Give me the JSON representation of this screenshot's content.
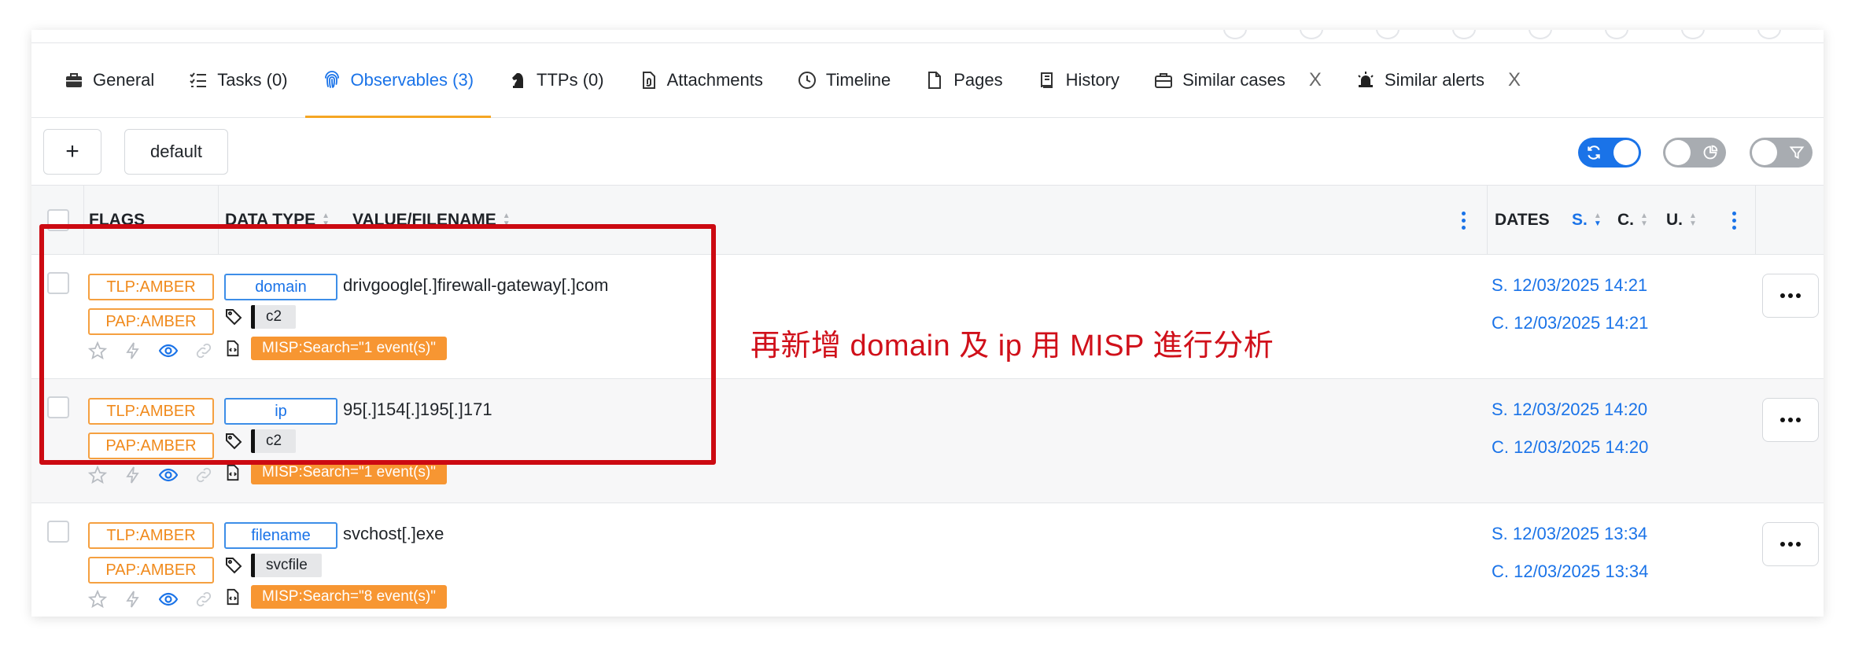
{
  "tabs": [
    {
      "label": "General",
      "icon": "briefcase-icon"
    },
    {
      "label": "Tasks (0)",
      "icon": "checklist-icon"
    },
    {
      "label": "Observables (3)",
      "icon": "fingerprint-icon",
      "active": true
    },
    {
      "label": "TTPs (0)",
      "icon": "chess-knight-icon"
    },
    {
      "label": "Attachments",
      "icon": "file-attachment-icon"
    },
    {
      "label": "Timeline",
      "icon": "clock-icon"
    },
    {
      "label": "Pages",
      "icon": "page-icon"
    },
    {
      "label": "History",
      "icon": "book-icon"
    },
    {
      "label": "Similar cases",
      "icon": "briefcase-icon",
      "closable": true
    },
    {
      "label": "Similar alerts",
      "icon": "siren-icon",
      "closable": true
    }
  ],
  "tab_close_symbol": "X",
  "toolbar": {
    "add_label": "+",
    "preset_label": "default",
    "toggles": [
      {
        "name": "auto-refresh",
        "state": "on",
        "icon": "refresh-icon"
      },
      {
        "name": "stats",
        "state": "off",
        "icon": "pie-chart-icon"
      },
      {
        "name": "filters",
        "state": "off",
        "icon": "filter-icon"
      }
    ]
  },
  "table": {
    "headers": {
      "flags": "FLAGS",
      "data_type": "DATA TYPE",
      "value": "VALUE/FILENAME",
      "dates": "DATES",
      "date_s": "S.",
      "date_c": "C.",
      "date_u": "U."
    },
    "rows": [
      {
        "tlp": "TLP:AMBER",
        "pap": "PAP:AMBER",
        "data_type": "domain",
        "value": "drivgoogle[.]firewall-gateway[.]com",
        "tag": "c2",
        "analyzer": "MISP:Search=\"1 event(s)\"",
        "start_date": "S. 12/03/2025 14:21",
        "created_date": "C. 12/03/2025 14:21"
      },
      {
        "tlp": "TLP:AMBER",
        "pap": "PAP:AMBER",
        "data_type": "ip",
        "value": "95[.]154[.]195[.]171",
        "tag": "c2",
        "analyzer": "MISP:Search=\"1 event(s)\"",
        "start_date": "S. 12/03/2025 14:20",
        "created_date": "C. 12/03/2025 14:20"
      },
      {
        "tlp": "TLP:AMBER",
        "pap": "PAP:AMBER",
        "data_type": "filename",
        "value": "svchost[.]exe",
        "tag": "svcfile",
        "analyzer": "MISP:Search=\"8 event(s)\"",
        "start_date": "S. 12/03/2025 13:34",
        "created_date": "C. 12/03/2025 13:34"
      }
    ]
  },
  "annotation": {
    "text": "再新增 domain 及 ip 用 MISP 進行分析",
    "color": "#d0101a"
  },
  "colors": {
    "accent": "#1a73e8",
    "tab_underline": "#f5a623",
    "amber": "#f08a1c",
    "misp_badge": "#f79632",
    "highlight_box": "#cc0a12"
  }
}
